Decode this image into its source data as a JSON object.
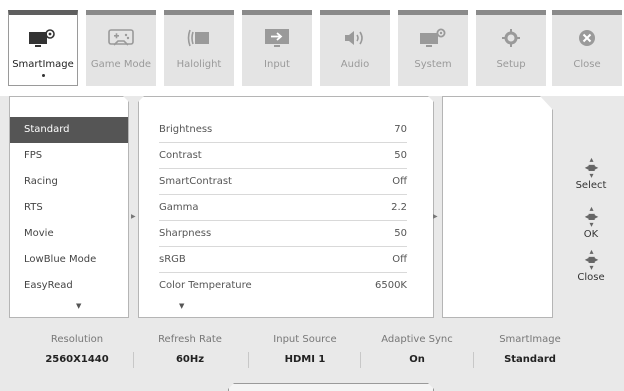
{
  "tabs": [
    {
      "label": "SmartImage",
      "icon": "smartimage-icon",
      "active": true
    },
    {
      "label": "Game Mode",
      "icon": "gamepad-icon",
      "active": false
    },
    {
      "label": "Halolight",
      "icon": "halolight-icon",
      "active": false
    },
    {
      "label": "Input",
      "icon": "input-icon",
      "active": false
    },
    {
      "label": "Audio",
      "icon": "speaker-icon",
      "active": false
    },
    {
      "label": "System",
      "icon": "system-icon",
      "active": false
    },
    {
      "label": "Setup",
      "icon": "gear-icon",
      "active": false
    },
    {
      "label": "Close",
      "icon": "close-icon",
      "active": false
    }
  ],
  "modes": {
    "items": [
      "Standard",
      "FPS",
      "Racing",
      "RTS",
      "Movie",
      "LowBlue Mode",
      "EasyRead"
    ],
    "selected": "Standard"
  },
  "settings": [
    {
      "name": "Brightness",
      "value": "70"
    },
    {
      "name": "Contrast",
      "value": "50"
    },
    {
      "name": "SmartContrast",
      "value": "Off"
    },
    {
      "name": "Gamma",
      "value": "2.2"
    },
    {
      "name": "Sharpness",
      "value": "50"
    },
    {
      "name": "sRGB",
      "value": "Off"
    },
    {
      "name": "Color Temperature",
      "value": "6500K"
    }
  ],
  "controls": {
    "select": "Select",
    "ok": "OK",
    "close": "Close"
  },
  "status": [
    {
      "label": "Resolution",
      "value": "2560X1440"
    },
    {
      "label": "Refresh Rate",
      "value": "60Hz"
    },
    {
      "label": "Input Source",
      "value": "HDMI 1"
    },
    {
      "label": "Adaptive Sync",
      "value": "On"
    },
    {
      "label": "SmartImage",
      "value": "Standard"
    }
  ],
  "colors": {
    "selected_bg": "#555555",
    "panel_bg": "#e9e9e9",
    "tab_inactive": "#e4e4e4"
  }
}
